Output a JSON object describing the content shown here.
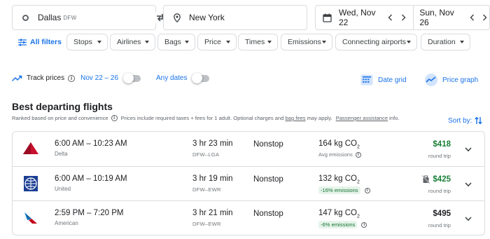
{
  "search": {
    "from_city": "Dallas",
    "from_code": "DFW",
    "to_city": "New York",
    "depart_date": "Wed, Nov 22",
    "return_date": "Sun, Nov 26"
  },
  "filters": {
    "all_filters": "All filters",
    "chips": [
      "Stops",
      "Airlines",
      "Bags",
      "Price",
      "Times",
      "Emissions",
      "Connecting airports",
      "Duration"
    ]
  },
  "track": {
    "label": "Track prices",
    "dates": "Nov 22 – 26",
    "any_dates": "Any dates",
    "date_grid": "Date grid",
    "price_graph": "Price graph"
  },
  "results": {
    "heading": "Best departing flights",
    "ranked_text": "Ranked based on price and convenience",
    "prices_text": "Prices include required taxes + fees for 1 adult. Optional charges and",
    "bag_fees": "bag fees",
    "may_apply": "may apply.",
    "passenger_assistance": "Passenger assistance",
    "info_suffix": "info.",
    "sort_by": "Sort by:"
  },
  "flights": [
    {
      "airline": "Delta",
      "times": "6:00 AM – 10:23 AM",
      "duration": "3 hr 23 min",
      "route": "DFW–LGA",
      "stops": "Nonstop",
      "co2": "164 kg CO",
      "co2_sub": "2",
      "emissions_note": "Avg emissions",
      "emissions_tag": "",
      "price": "$418",
      "price_note": "round trip",
      "price_color": "#188038",
      "logo": "delta-logo-icon"
    },
    {
      "airline": "United",
      "times": "6:00 AM – 10:19 AM",
      "duration": "3 hr 19 min",
      "route": "DFW–EWR",
      "stops": "Nonstop",
      "co2": "132 kg CO",
      "co2_sub": "2",
      "emissions_note": "",
      "emissions_tag": "-16% emissions",
      "price": "$425",
      "price_note": "round trip",
      "price_color": "#188038",
      "logo": "united-logo-icon"
    },
    {
      "airline": "American",
      "times": "2:59 PM – 7:20 PM",
      "duration": "3 hr 21 min",
      "route": "DFW–EWR",
      "stops": "Nonstop",
      "co2": "147 kg CO",
      "co2_sub": "2",
      "emissions_note": "",
      "emissions_tag": "-6% emissions",
      "price": "$495",
      "price_note": "round trip",
      "price_color": "#202124",
      "logo": "american-logo-icon"
    }
  ],
  "colors": {
    "accent": "#1a73e8",
    "green_price": "#188038",
    "emissions_tag_bg": "#e6f4ea"
  }
}
